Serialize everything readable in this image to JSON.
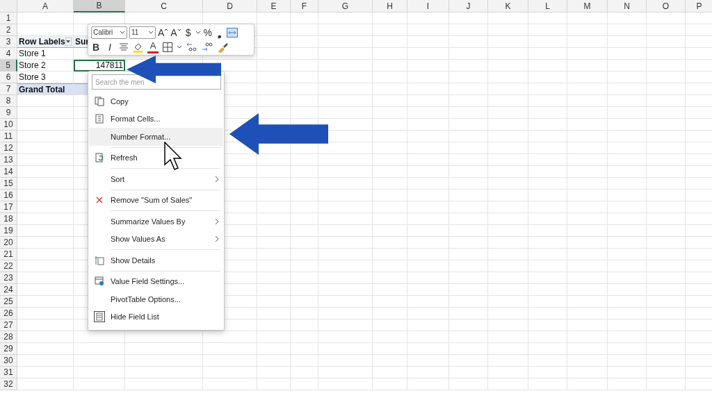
{
  "columns": [
    {
      "label": "A",
      "selected": false
    },
    {
      "label": "B",
      "selected": true
    },
    {
      "label": "C",
      "selected": false
    },
    {
      "label": "D",
      "selected": false
    },
    {
      "label": "E",
      "selected": false
    },
    {
      "label": "F",
      "selected": false
    },
    {
      "label": "G",
      "selected": false
    },
    {
      "label": "H",
      "selected": false
    },
    {
      "label": "I",
      "selected": false
    },
    {
      "label": "J",
      "selected": false
    },
    {
      "label": "K",
      "selected": false
    },
    {
      "label": "L",
      "selected": false
    },
    {
      "label": "M",
      "selected": false
    },
    {
      "label": "N",
      "selected": false
    },
    {
      "label": "O",
      "selected": false
    },
    {
      "label": "P",
      "selected": false
    }
  ],
  "rows": [
    {
      "label": "1",
      "selected": false,
      "kind": "plain",
      "cells": []
    },
    {
      "label": "2",
      "selected": false,
      "kind": "plain",
      "cells": []
    },
    {
      "label": "3",
      "selected": false,
      "kind": "header",
      "cells": [
        {
          "text": "Row Labels",
          "kind": "text",
          "filter": true,
          "selected": false
        },
        {
          "text": "Sur",
          "kind": "text",
          "selected": false
        }
      ]
    },
    {
      "label": "4",
      "selected": false,
      "kind": "plain",
      "cells": [
        {
          "text": "Store 1",
          "kind": "text",
          "filter": false,
          "selected": false
        }
      ]
    },
    {
      "label": "5",
      "selected": true,
      "kind": "plain",
      "cells": [
        {
          "text": "Store 2",
          "kind": "text",
          "filter": false,
          "selected": false
        },
        {
          "text": "147811",
          "kind": "number",
          "filter": false,
          "selected": true
        }
      ]
    },
    {
      "label": "6",
      "selected": false,
      "kind": "plain",
      "cells": [
        {
          "text": "Store 3",
          "kind": "text",
          "filter": false,
          "selected": false
        }
      ]
    },
    {
      "label": "7",
      "selected": false,
      "kind": "total",
      "cells": [
        {
          "text": "Grand Total",
          "kind": "text",
          "filter": false,
          "selected": false
        }
      ]
    },
    {
      "label": "8",
      "selected": false,
      "kind": "plain",
      "cells": []
    },
    {
      "label": "9",
      "selected": false,
      "kind": "plain",
      "cells": []
    },
    {
      "label": "10",
      "selected": false,
      "kind": "plain",
      "cells": []
    },
    {
      "label": "11",
      "selected": false,
      "kind": "plain",
      "cells": []
    },
    {
      "label": "12",
      "selected": false,
      "kind": "plain",
      "cells": []
    },
    {
      "label": "13",
      "selected": false,
      "kind": "plain",
      "cells": []
    },
    {
      "label": "14",
      "selected": false,
      "kind": "plain",
      "cells": []
    },
    {
      "label": "15",
      "selected": false,
      "kind": "plain",
      "cells": []
    },
    {
      "label": "16",
      "selected": false,
      "kind": "plain",
      "cells": []
    },
    {
      "label": "17",
      "selected": false,
      "kind": "plain",
      "cells": []
    },
    {
      "label": "18",
      "selected": false,
      "kind": "plain",
      "cells": []
    },
    {
      "label": "19",
      "selected": false,
      "kind": "plain",
      "cells": []
    },
    {
      "label": "20",
      "selected": false,
      "kind": "plain",
      "cells": []
    },
    {
      "label": "21",
      "selected": false,
      "kind": "plain",
      "cells": []
    },
    {
      "label": "22",
      "selected": false,
      "kind": "plain",
      "cells": []
    },
    {
      "label": "23",
      "selected": false,
      "kind": "plain",
      "cells": []
    },
    {
      "label": "24",
      "selected": false,
      "kind": "plain",
      "cells": []
    },
    {
      "label": "25",
      "selected": false,
      "kind": "plain",
      "cells": []
    },
    {
      "label": "26",
      "selected": false,
      "kind": "plain",
      "cells": []
    },
    {
      "label": "27",
      "selected": false,
      "kind": "plain",
      "cells": []
    },
    {
      "label": "28",
      "selected": false,
      "kind": "plain",
      "cells": []
    },
    {
      "label": "29",
      "selected": false,
      "kind": "plain",
      "cells": []
    },
    {
      "label": "30",
      "selected": false,
      "kind": "plain",
      "cells": []
    },
    {
      "label": "31",
      "selected": false,
      "kind": "plain",
      "cells": []
    },
    {
      "label": "32",
      "selected": false,
      "kind": "plain",
      "cells": []
    }
  ],
  "mini_toolbar": {
    "font": "Calibri",
    "size": "11",
    "row_1": [
      {
        "kind": "grow",
        "label": "A"
      },
      {
        "kind": "shrink",
        "label": "A"
      },
      {
        "kind": "currency",
        "label": "$"
      },
      {
        "kind": "caret"
      },
      {
        "kind": "percent",
        "label": "%"
      },
      {
        "kind": "comma",
        "label": "❟"
      },
      {
        "kind": "merge"
      }
    ],
    "row_2": [
      {
        "kind": "bold",
        "label": "B"
      },
      {
        "kind": "italic",
        "label": "I"
      },
      {
        "kind": "align"
      },
      {
        "kind": "fill"
      },
      {
        "kind": "fontcolor",
        "label": "A"
      },
      {
        "kind": "borders"
      },
      {
        "kind": "caret"
      },
      {
        "kind": "decrease"
      },
      {
        "kind": "increase"
      },
      {
        "kind": "painter"
      }
    ]
  },
  "context_menu": {
    "search": {
      "placeholder": "Search the men"
    },
    "items": [
      {
        "kind": "copy",
        "label": "Copy",
        "submenu": false,
        "selected": false
      },
      {
        "kind": "format",
        "label": "Format Cells...",
        "submenu": false,
        "selected": false
      },
      {
        "kind": "plain",
        "label": "Number Format...",
        "submenu": false,
        "selected": true
      },
      {
        "kind": "separator"
      },
      {
        "kind": "refresh",
        "label": "Refresh",
        "submenu": false,
        "selected": false
      },
      {
        "kind": "separator"
      },
      {
        "kind": "plain",
        "label": "Sort",
        "submenu": true,
        "selected": false
      },
      {
        "kind": "separator"
      },
      {
        "kind": "remove",
        "label": "Remove \"Sum of Sales\"",
        "submenu": false,
        "selected": false
      },
      {
        "kind": "separator"
      },
      {
        "kind": "plain",
        "label": "Summarize Values By",
        "submenu": true,
        "selected": false
      },
      {
        "kind": "plain",
        "label": "Show Values As",
        "submenu": true,
        "selected": false
      },
      {
        "kind": "separator"
      },
      {
        "kind": "details",
        "label": "Show Details",
        "submenu": false,
        "selected": false
      },
      {
        "kind": "separator"
      },
      {
        "kind": "settings",
        "label": "Value Field Settings...",
        "submenu": false,
        "selected": false
      },
      {
        "kind": "plain",
        "label": "PivotTable Options...",
        "submenu": false,
        "selected": false
      },
      {
        "kind": "fieldlist",
        "label": "Hide Field List",
        "submenu": false,
        "selected": false
      }
    ]
  }
}
